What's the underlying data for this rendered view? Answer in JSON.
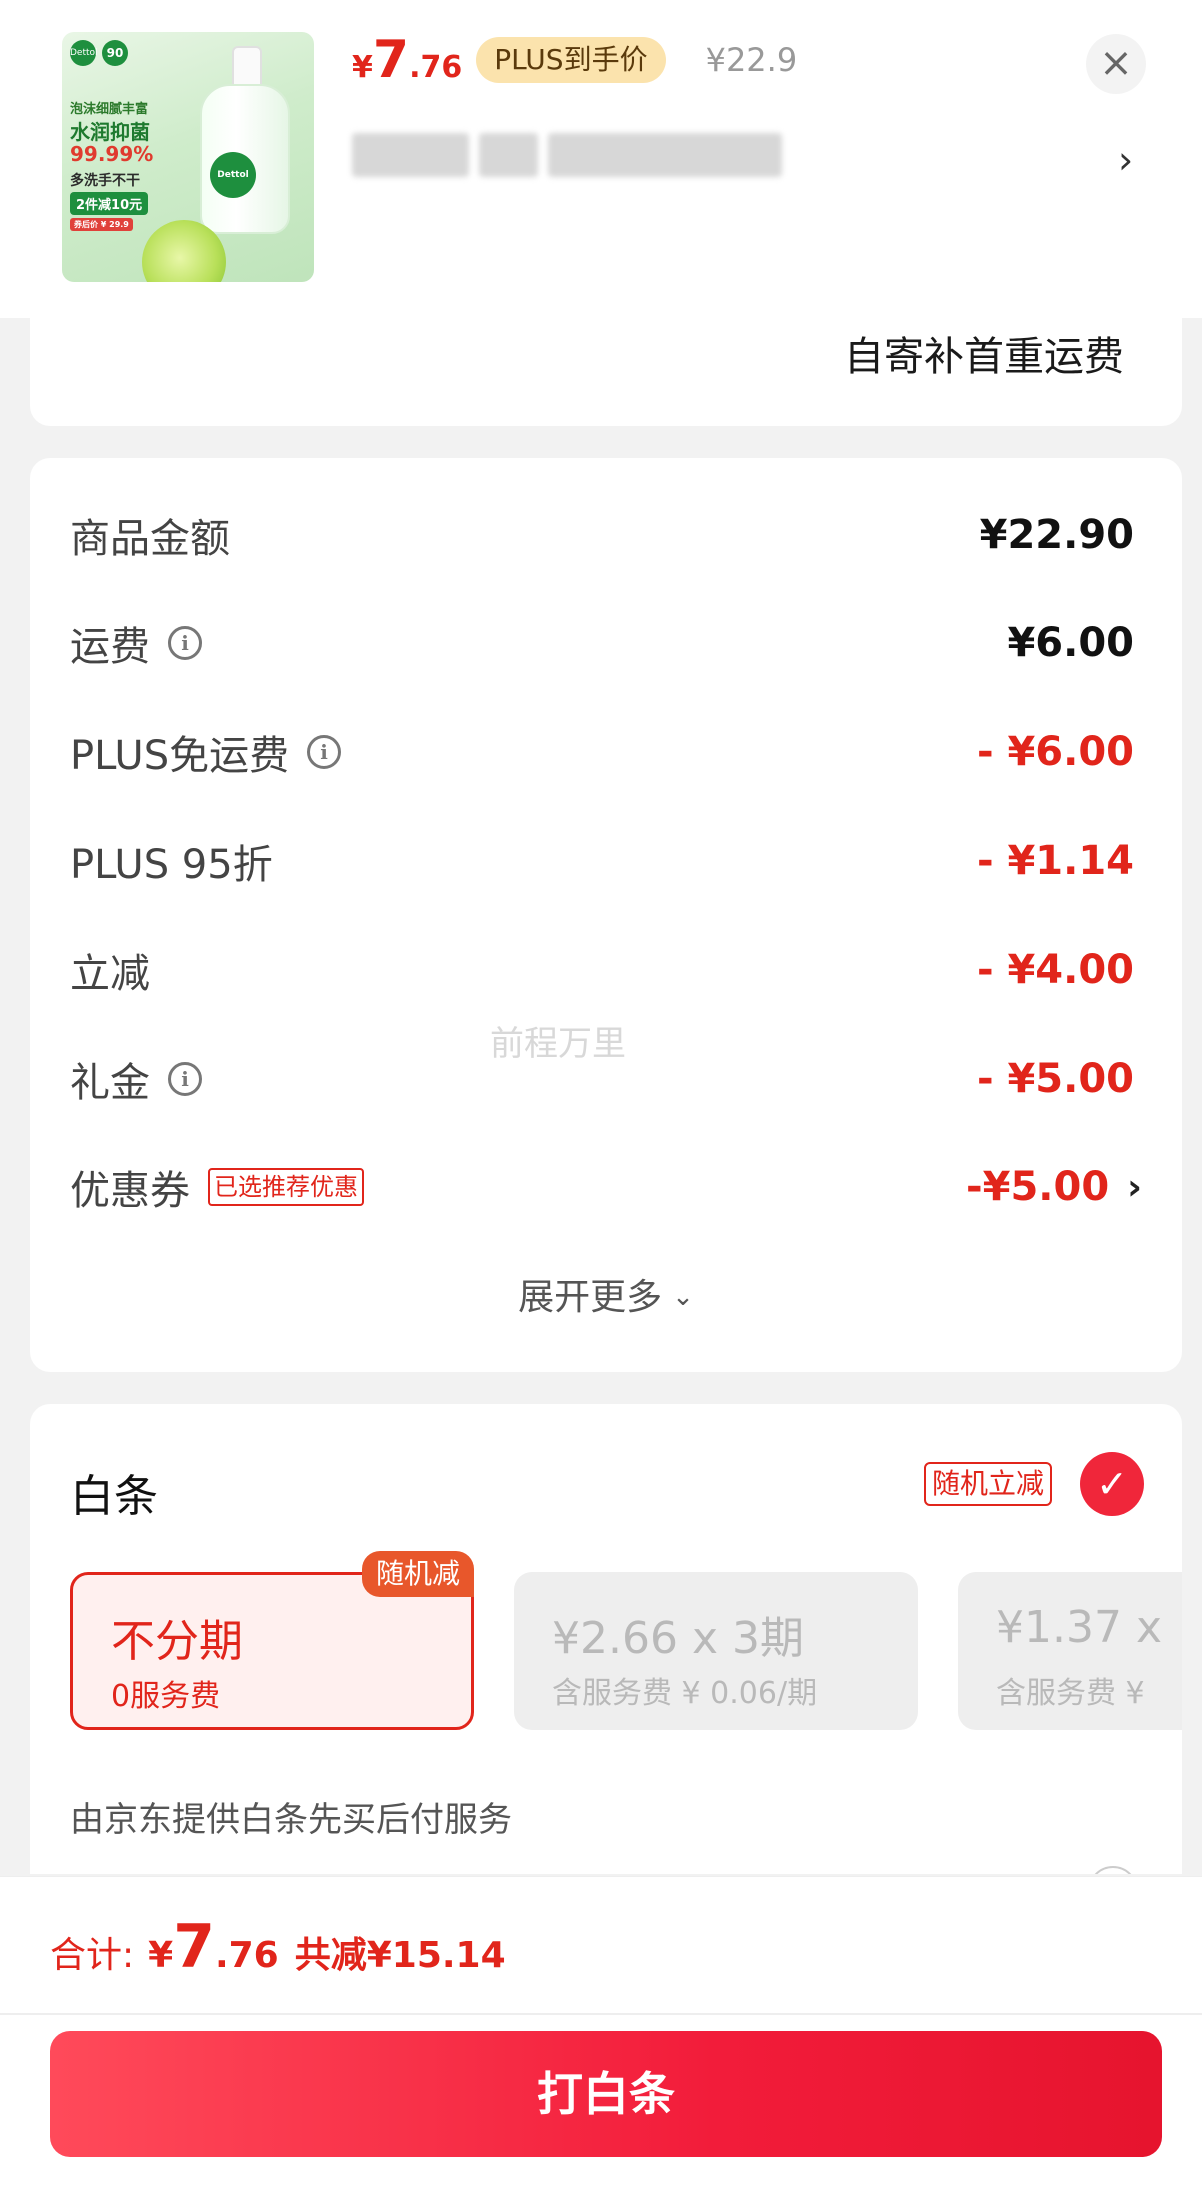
{
  "product": {
    "image": {
      "brand": "Dettol",
      "badge": "90",
      "lines": [
        "泡沫细腻丰富",
        "水润抑菌",
        "99.99%",
        "多洗手不干",
        "2件减10元",
        "券后价 ¥ 29.9"
      ]
    },
    "price_yen": "¥",
    "price_int": "7",
    "price_dec": ".76",
    "plus_tag": "PLUS到手价",
    "orig_price": "¥22.9",
    "close_icon": "×",
    "chevron": "›"
  },
  "shipping_note": "自寄补首重运费",
  "details": {
    "rows": [
      {
        "label": "商品金额",
        "value": "¥22.90",
        "info": false,
        "red": false
      },
      {
        "label": "运费",
        "value": "¥6.00",
        "info": true,
        "red": false
      },
      {
        "label": "PLUS免运费",
        "value": "- ¥6.00",
        "info": true,
        "red": true
      },
      {
        "label": "PLUS 95折",
        "value": "- ¥1.14",
        "info": false,
        "red": true
      },
      {
        "label": "立减",
        "value": "- ¥4.00",
        "info": false,
        "red": true
      },
      {
        "label": "礼金",
        "value": "- ¥5.00",
        "info": true,
        "red": true
      }
    ],
    "coupon": {
      "label": "优惠券",
      "tag": "已选推荐优惠",
      "value": "-¥5.00",
      "chevron": "›"
    },
    "watermark": "前程万里",
    "expand": "展开更多",
    "expand_chev": "⌄"
  },
  "baitiao": {
    "title": "白条",
    "random_tag": "随机立减",
    "check": "✓",
    "options": [
      {
        "main": "不分期",
        "sub": "0服务费",
        "badge": "随机减"
      },
      {
        "main": "¥2.66 x 3期",
        "sub": "含服务费 ¥ 0.06/期"
      },
      {
        "main": "¥1.37 x",
        "sub": "含服务费 ¥"
      }
    ],
    "desc": "由京东提供白条先买后付服务"
  },
  "footer": {
    "total_label": "合计:",
    "total_yen": "¥",
    "total_int": "7",
    "total_dec": ".76",
    "saved": "共减¥15.14",
    "pay_button": "打白条"
  },
  "colors": {
    "accent_red": "#e1251b",
    "plus_gold": "#fbe3ad",
    "button_gradient_start": "#ff4a5a",
    "button_gradient_end": "#e6142e"
  }
}
